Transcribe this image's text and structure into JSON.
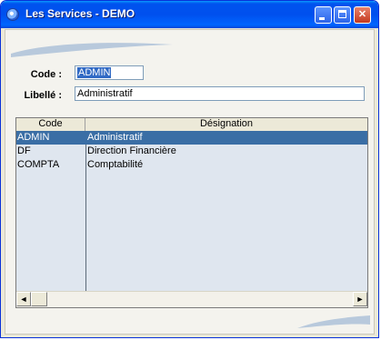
{
  "window": {
    "title": "Les Services - DEMO",
    "min_glyph": "_",
    "max_glyph": "□",
    "close_glyph": "✕"
  },
  "form": {
    "code_label": "Code :",
    "code_value": "ADMIN",
    "libelle_label": "Libellé :",
    "libelle_value": "Administratif"
  },
  "grid": {
    "columns": [
      "Code",
      "Désignation"
    ],
    "rows": [
      {
        "code": "ADMIN",
        "designation": "Administratif",
        "selected": true
      },
      {
        "code": "DF",
        "designation": "Direction Financière",
        "selected": false
      },
      {
        "code": "COMPTA",
        "designation": "Comptabilité",
        "selected": false
      }
    ],
    "scroll_left_glyph": "◄",
    "scroll_right_glyph": "►"
  },
  "colors": {
    "title_bar": "#0053ee",
    "selection": "#3a6ea5",
    "grid_background": "#dfe6ef"
  },
  "icons": [
    "app-icon",
    "minimize-icon",
    "maximize-icon",
    "close-icon",
    "scroll-left-arrow-icon",
    "scroll-right-arrow-icon"
  ]
}
